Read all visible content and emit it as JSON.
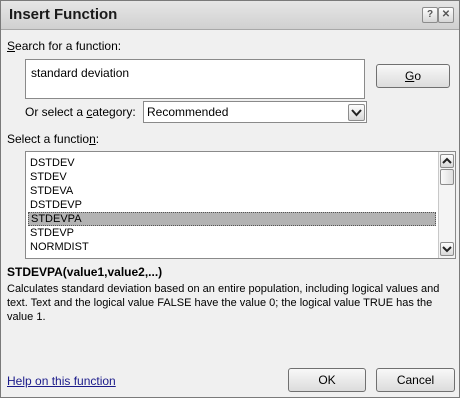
{
  "window": {
    "title": "Insert Function",
    "help_glyph": "?",
    "close_glyph": "✕"
  },
  "search": {
    "label_accel": "S",
    "label_rest": "earch for a function:",
    "value": "standard deviation",
    "go_accel": "G",
    "go_rest": "o"
  },
  "category": {
    "label_pre": "Or select a ",
    "label_accel": "c",
    "label_post": "ategory:",
    "selected": "Recommended"
  },
  "functions": {
    "label_pre": "Select a functio",
    "label_accel": "n",
    "label_post": ":",
    "items": [
      "DSTDEV",
      "STDEV",
      "STDEVA",
      "DSTDEVP",
      "STDEVPA",
      "STDEVP",
      "NORMDIST"
    ],
    "selected": "STDEVPA"
  },
  "description": {
    "signature": "STDEVPA(value1,value2,...)",
    "text": "Calculates standard deviation based on an entire population, including logical values and text. Text and the logical value FALSE have the value 0; the logical value TRUE has the value 1."
  },
  "footer": {
    "help_link": "Help on this function",
    "ok": "OK",
    "cancel": "Cancel"
  },
  "colors": {
    "selection": "#b3b3b3",
    "link": "#1a1a8a",
    "title_text": "#1a1a1a"
  }
}
